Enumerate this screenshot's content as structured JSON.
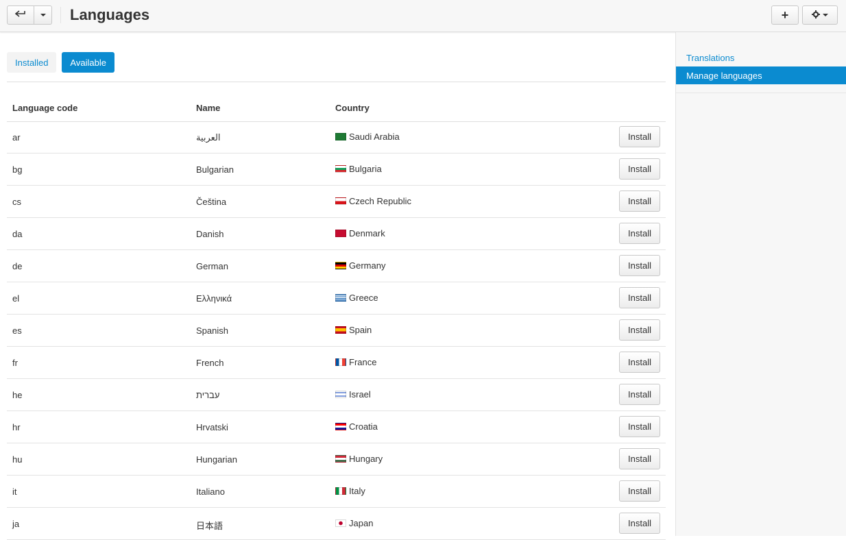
{
  "header": {
    "title": "Languages",
    "plus_label": "+"
  },
  "tabs": [
    {
      "label": "Installed",
      "active": false
    },
    {
      "label": "Available",
      "active": true
    }
  ],
  "table": {
    "headers": [
      "Language code",
      "Name",
      "Country"
    ],
    "install_label": "Install",
    "rows": [
      {
        "code": "ar",
        "name": "العربية",
        "country": "Saudi Arabia",
        "flag_icon": "flag-sa-icon"
      },
      {
        "code": "bg",
        "name": "Bulgarian",
        "country": "Bulgaria",
        "flag_icon": "flag-bg-icon"
      },
      {
        "code": "cs",
        "name": "Čeština",
        "country": "Czech Republic",
        "flag_icon": "flag-cz-icon"
      },
      {
        "code": "da",
        "name": "Danish",
        "country": "Denmark",
        "flag_icon": "flag-dk-icon"
      },
      {
        "code": "de",
        "name": "German",
        "country": "Germany",
        "flag_icon": "flag-de-icon"
      },
      {
        "code": "el",
        "name": "Ελληνικά",
        "country": "Greece",
        "flag_icon": "flag-gr-icon"
      },
      {
        "code": "es",
        "name": "Spanish",
        "country": "Spain",
        "flag_icon": "flag-es-icon"
      },
      {
        "code": "fr",
        "name": "French",
        "country": "France",
        "flag_icon": "flag-fr-icon"
      },
      {
        "code": "he",
        "name": "עברית",
        "country": "Israel",
        "flag_icon": "flag-il-icon"
      },
      {
        "code": "hr",
        "name": "Hrvatski",
        "country": "Croatia",
        "flag_icon": "flag-hr-icon"
      },
      {
        "code": "hu",
        "name": "Hungarian",
        "country": "Hungary",
        "flag_icon": "flag-hu-icon"
      },
      {
        "code": "it",
        "name": "Italiano",
        "country": "Italy",
        "flag_icon": "flag-it-icon"
      },
      {
        "code": "ja",
        "name": "日本語",
        "country": "Japan",
        "flag_icon": "flag-jp-icon"
      }
    ]
  },
  "sidebar": {
    "items": [
      {
        "label": "Translations",
        "active": false
      },
      {
        "label": "Manage languages",
        "active": true
      }
    ]
  },
  "colors": {
    "accent": "#0b8bd0",
    "topbar_bg": "#f7f7f7",
    "sidebar_bg": "#f7f7f7"
  }
}
